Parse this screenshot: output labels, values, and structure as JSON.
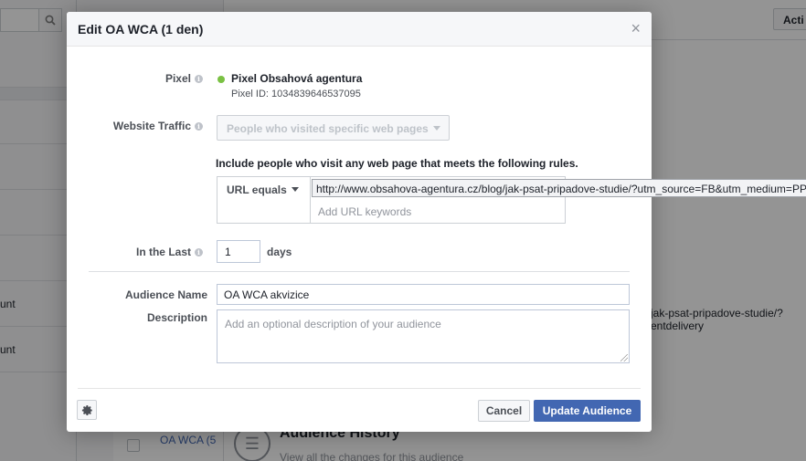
{
  "background": {
    "left_rows": [
      "unt",
      "unt"
    ],
    "actions_label": "Acti",
    "url_snippet": [
      "jak-psat-pripadove-studie/?",
      "entdelivery"
    ],
    "list_item": "OA WCA (5",
    "history_title": "Audience History",
    "history_subtitle": "View all the changes for this audience"
  },
  "dialog": {
    "title": "Edit OA WCA (1 den)",
    "close": "×",
    "pixel": {
      "label": "Pixel",
      "name": "Pixel Obsahová agentura",
      "id": "Pixel ID: 1034839646537095",
      "status_color": "#7ac143"
    },
    "website_traffic": {
      "label": "Website Traffic",
      "value": "People who visited specific web pages"
    },
    "rules": {
      "heading": "Include people who visit any web page that meets the following rules.",
      "type": "URL equals",
      "url": "http://www.obsahova-agentura.cz/blog/jak-psat-pripadove-studie/?utm_source=FB&utm_medium=PPC",
      "placeholder": "Add URL keywords"
    },
    "in_the_last": {
      "label": "In the Last",
      "value": "1",
      "unit": "days"
    },
    "audience_name": {
      "label": "Audience Name",
      "value": "OA WCA akvizice"
    },
    "description": {
      "label": "Description",
      "placeholder": "Add an optional description of your audience"
    },
    "footer": {
      "settings_icon": "gear-icon",
      "cancel": "Cancel",
      "update": "Update Audience",
      "primary_color": "#4267b2"
    }
  }
}
